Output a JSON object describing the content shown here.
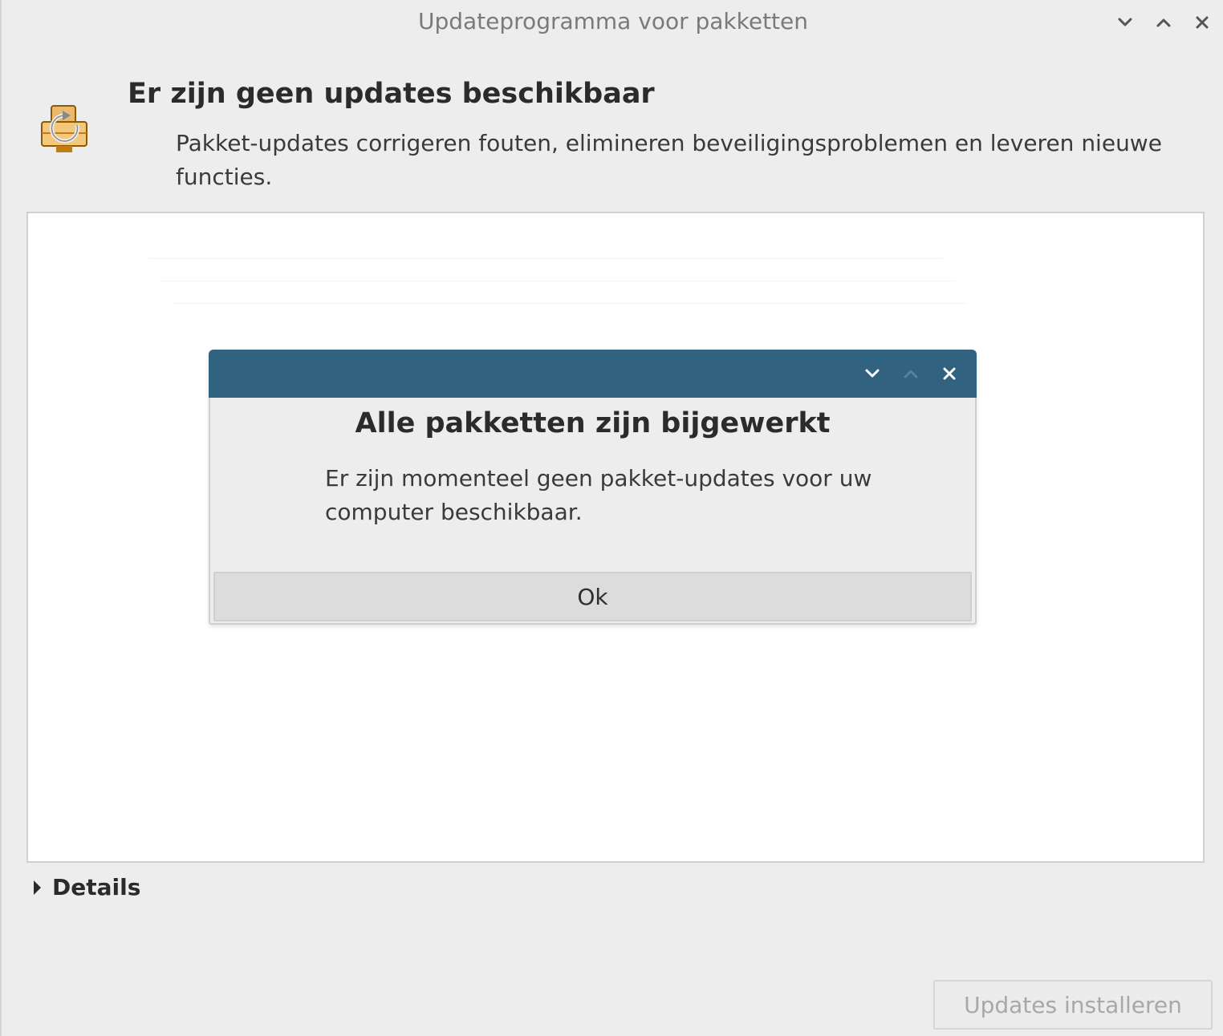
{
  "window": {
    "title": "Updateprogramma voor pakketten"
  },
  "header": {
    "heading": "Er zijn geen updates beschikbaar",
    "description": "Pakket-updates corrigeren fouten, elimineren beveiligingsproblemen en leveren nieuwe functies."
  },
  "details": {
    "label": "Details"
  },
  "footer": {
    "install_label": "Updates installeren"
  },
  "dialog": {
    "title": "Alle pakketten zijn bijgewerkt",
    "message": "Er zijn momenteel geen pakket-updates voor uw computer beschikbaar.",
    "ok_label": "Ok",
    "titlebar_color": "#31627f"
  },
  "icons": {
    "window_minimize": "chevron-down-icon",
    "window_maximize": "chevron-up-icon",
    "window_close": "close-icon",
    "app": "package-update-icon",
    "details_toggle": "triangle-right-icon"
  }
}
